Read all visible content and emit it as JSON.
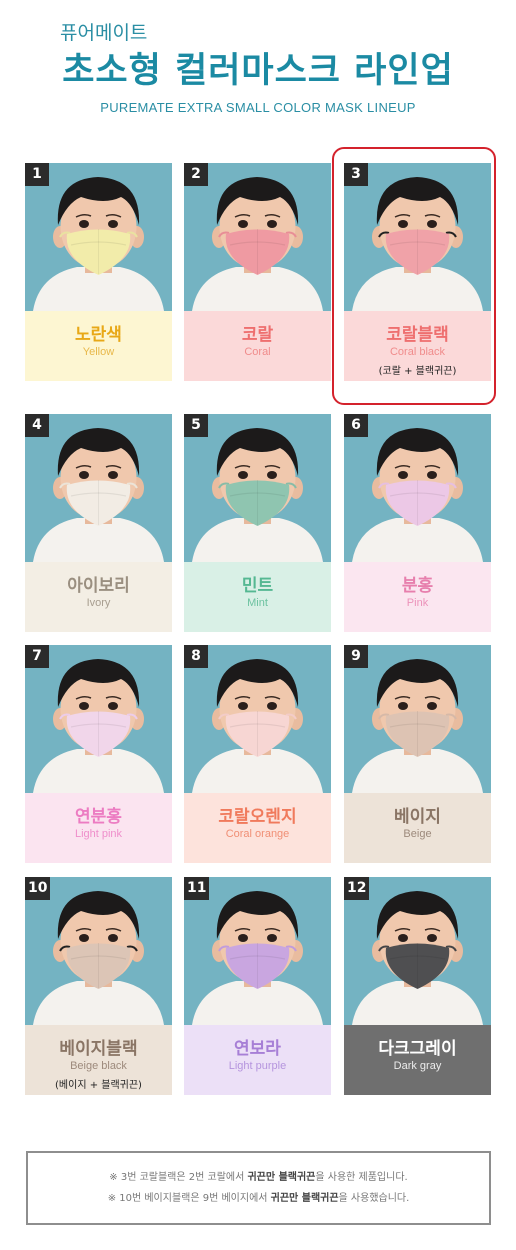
{
  "header": {
    "brand": "퓨어메이트",
    "title": "초소형 컬러마스크 라인업",
    "subtitle": "PUREMATE EXTRA SMALL COLOR MASK LINEUP"
  },
  "products": [
    {
      "num": "1",
      "name_ko": "노란색",
      "name_en": "Yellow",
      "note": "",
      "mask": "#f2ecaa",
      "ear": "#e9e2a0",
      "label_bg": "#fdf6d2",
      "label_color": "#e8a817",
      "en_color": "#e8b84a"
    },
    {
      "num": "2",
      "name_ko": "코랄",
      "name_en": "Coral",
      "note": "",
      "mask": "#ef9aa2",
      "ear": "#e88e96",
      "label_bg": "#fbd9d9",
      "label_color": "#ee6f6f",
      "en_color": "#f08c8c"
    },
    {
      "num": "3",
      "name_ko": "코랄블랙",
      "name_en": "Coral black",
      "note": "(코랄 + 블랙귀끈)",
      "mask": "#f0a2a8",
      "ear": "#222222",
      "label_bg": "#fbd9d9",
      "label_color": "#ee6f6f",
      "en_color": "#f08c8c"
    },
    {
      "num": "4",
      "name_ko": "아이보리",
      "name_en": "Ivory",
      "note": "",
      "mask": "#f2ece4",
      "ear": "#ece4d8",
      "label_bg": "#f3eee4",
      "label_color": "#9a8f80",
      "en_color": "#a79d8f"
    },
    {
      "num": "5",
      "name_ko": "민트",
      "name_en": "Mint",
      "note": "",
      "mask": "#8fc5b0",
      "ear": "#88bca7",
      "label_bg": "#d9f0e6",
      "label_color": "#55b892",
      "en_color": "#6cc2a0"
    },
    {
      "num": "6",
      "name_ko": "분홍",
      "name_en": "Pink",
      "note": "",
      "mask": "#ecc8e6",
      "ear": "#e6bfe0",
      "label_bg": "#fbe6f0",
      "label_color": "#e77fad",
      "en_color": "#ec92ba"
    },
    {
      "num": "7",
      "name_ko": "연분홍",
      "name_en": "Light pink",
      "note": "",
      "mask": "#f1d6ea",
      "ear": "#ecccea",
      "label_bg": "#fbe4f0",
      "label_color": "#ec7cc2",
      "en_color": "#ef8ecb"
    },
    {
      "num": "8",
      "name_ko": "코랄오렌지",
      "name_en": "Coral orange",
      "note": "",
      "mask": "#f7d6d3",
      "ear": "#f3ccc8",
      "label_bg": "#fde3dc",
      "label_color": "#f07a5c",
      "en_color": "#f08f75"
    },
    {
      "num": "9",
      "name_ko": "베이지",
      "name_en": "Beige",
      "note": "",
      "mask": "#ddc3b3",
      "ear": "#d6b9a8",
      "label_bg": "#ede3d8",
      "label_color": "#8a7565",
      "en_color": "#9d8a7c"
    },
    {
      "num": "10",
      "name_ko": "베이지블랙",
      "name_en": "Beige black",
      "note": "(베이지 + 블랙귀끈)",
      "mask": "#dcc5b6",
      "ear": "#222222",
      "label_bg": "#ede3d8",
      "label_color": "#8a7565",
      "en_color": "#9d8a7c"
    },
    {
      "num": "11",
      "name_ko": "연보라",
      "name_en": "Light purple",
      "note": "",
      "mask": "#c9a6e0",
      "ear": "#c19cdb",
      "label_bg": "#ece0f7",
      "label_color": "#a77fd6",
      "en_color": "#b594de"
    },
    {
      "num": "12",
      "name_ko": "다크그레이",
      "name_en": "Dark gray",
      "note": "",
      "mask": "#4f4f51",
      "ear": "#454547",
      "label_bg": "#6f6f6f",
      "label_color": "#ffffff",
      "en_color": "#ececec"
    }
  ],
  "footnote": {
    "line1_a": "※ 3번 코랄블랙은 2번 코랄에서 ",
    "line1_b": "귀끈만 블랙귀끈",
    "line1_c": "을 사용한 제품입니다.",
    "line2_a": "※ 10번 베이지블랙은 9번 베이지에서 ",
    "line2_b": "귀끈만 블랙귀끈",
    "line2_c": "을 사용했습니다."
  }
}
